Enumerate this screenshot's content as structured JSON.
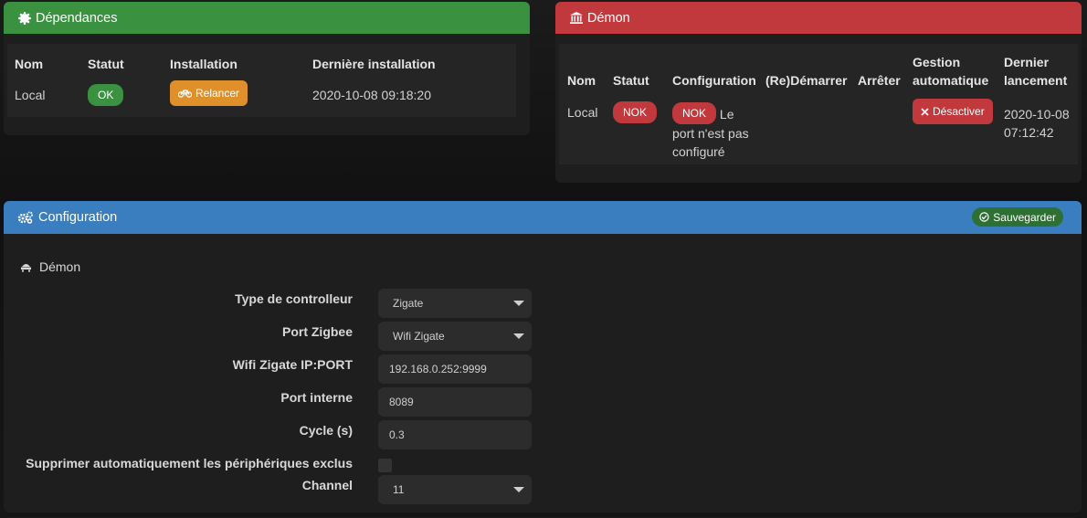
{
  "dependencies": {
    "title": "Dépendances",
    "headers": [
      "Nom",
      "Statut",
      "Installation",
      "Dernière installation"
    ],
    "row": {
      "name": "Local",
      "status": "OK",
      "install_button": "Relancer",
      "last_install": "2020-10-08 09:18:20"
    }
  },
  "daemon": {
    "title": "Démon",
    "headers": [
      "Nom",
      "Statut",
      "Configuration",
      "(Re)Démarrer",
      "Arrêter",
      "Gestion automatique",
      "Dernier lancement"
    ],
    "row": {
      "name": "Local",
      "status": "NOK",
      "config_badge": "NOK",
      "config_message": "Le port n'est pas configuré",
      "auto_button": "Désactiver",
      "last_launch": "2020-10-08 07:12:42"
    }
  },
  "configuration": {
    "title": "Configuration",
    "save_label": "Sauvegarder",
    "section_title": "Démon",
    "fields": {
      "controller_type": {
        "label": "Type de controlleur",
        "value": "Zigate"
      },
      "zigbee_port": {
        "label": "Port Zigbee",
        "value": "Wifi Zigate"
      },
      "wifi_ip_port": {
        "label": "Wifi Zigate IP:PORT",
        "value": "192.168.0.252:9999"
      },
      "internal_port": {
        "label": "Port interne",
        "value": "8089"
      },
      "cycle": {
        "label": "Cycle (s)",
        "value": "0.3"
      },
      "auto_delete": {
        "label": "Supprimer automatiquement les périphériques exclus",
        "checked": false
      },
      "channel": {
        "label": "Channel",
        "value": "11"
      }
    }
  },
  "colors": {
    "green": "#3a9240",
    "red": "#c1393d",
    "blue": "#3a7ebf",
    "orange": "#e0902b"
  }
}
